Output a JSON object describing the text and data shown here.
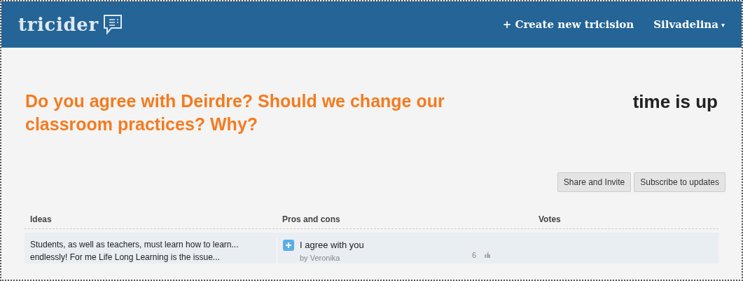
{
  "header": {
    "logo": "tricider",
    "links": [
      "+ Create new tricision"
    ],
    "user": "Silvadelina",
    "user_caret": "▾"
  },
  "question": "Do you agree with Deirdre? Should we change our classroom practices? Why?",
  "status": "time is up",
  "buttons": [
    "Share and Invite",
    "Subscribe to updates"
  ],
  "table": {
    "columns": [
      "Ideas",
      "Pros and cons",
      "Votes"
    ],
    "rows": [
      {
        "idea": "Students, as well as teachers, must learn how to learn... endlessly! For me Life Long Learning is the issue...",
        "arguments": [
          {
            "kind": "pro",
            "text": "I agree with you",
            "author": "by Veronika",
            "likes": "6"
          }
        ]
      }
    ]
  }
}
